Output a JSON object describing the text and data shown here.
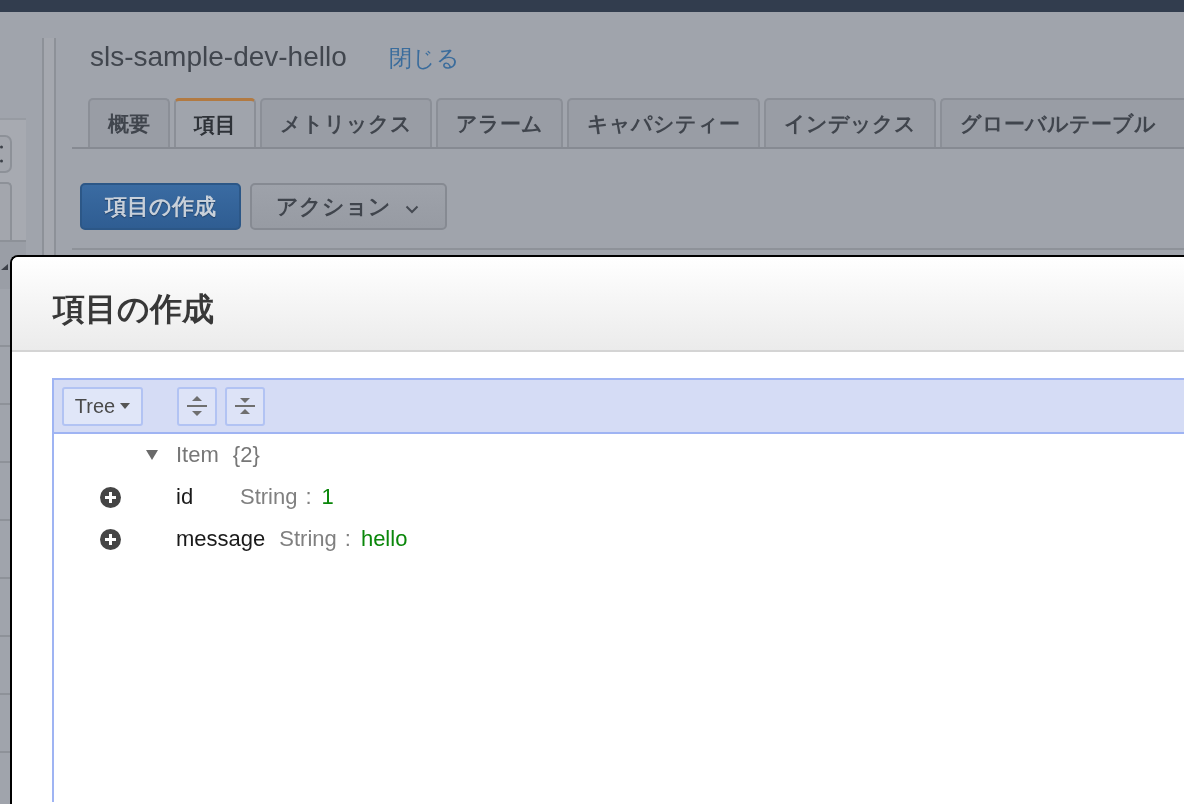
{
  "page": {
    "title": "sls-sample-dev-hello",
    "close_link": "閉じる",
    "tabs": [
      {
        "label": "概要",
        "selected": false
      },
      {
        "label": "項目",
        "selected": true
      },
      {
        "label": "メトリックス",
        "selected": false
      },
      {
        "label": "アラーム",
        "selected": false
      },
      {
        "label": "キャパシティー",
        "selected": false
      },
      {
        "label": "インデックス",
        "selected": false
      },
      {
        "label": "グローバルテーブル",
        "selected": false
      }
    ],
    "actions": [
      {
        "label": "項目の作成",
        "kind": "primary"
      },
      {
        "label": "アクション",
        "kind": "dropdown"
      }
    ]
  },
  "dialog": {
    "title": "項目の作成",
    "editor": {
      "mode": "Tree",
      "tree": [
        {
          "label": "Item",
          "count": "{2}",
          "expanded": true,
          "children": [
            {
              "key": "id",
              "type": "String",
              "separator": ":",
              "value": "1"
            },
            {
              "key": "message",
              "type": "String",
              "separator": ":",
              "value": "hello"
            }
          ]
        }
      ]
    }
  }
}
